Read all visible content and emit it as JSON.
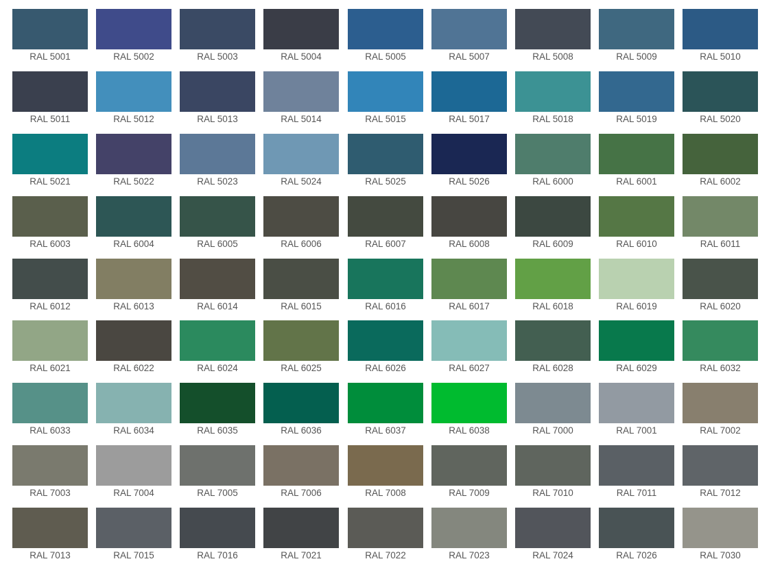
{
  "swatches": [
    {
      "label": "RAL 5001",
      "color": "#37596f"
    },
    {
      "label": "RAL 5002",
      "color": "#3f4b8a"
    },
    {
      "label": "RAL 5003",
      "color": "#3a4a64"
    },
    {
      "label": "RAL 5004",
      "color": "#3a3d47"
    },
    {
      "label": "RAL 5005",
      "color": "#2c5e8f"
    },
    {
      "label": "RAL 5007",
      "color": "#507495"
    },
    {
      "label": "RAL 5008",
      "color": "#434a55"
    },
    {
      "label": "RAL 5009",
      "color": "#3f6880"
    },
    {
      "label": "RAL 5010",
      "color": "#2c5a85"
    },
    {
      "label": "RAL 5011",
      "color": "#3a404e"
    },
    {
      "label": "RAL 5012",
      "color": "#438fbc"
    },
    {
      "label": "RAL 5013",
      "color": "#3a4662"
    },
    {
      "label": "RAL 5014",
      "color": "#6f829b"
    },
    {
      "label": "RAL 5015",
      "color": "#3285b9"
    },
    {
      "label": "RAL 5017",
      "color": "#1c6895"
    },
    {
      "label": "RAL 5018",
      "color": "#3c9294"
    },
    {
      "label": "RAL 5019",
      "color": "#33688f"
    },
    {
      "label": "RAL 5020",
      "color": "#2b5458"
    },
    {
      "label": "RAL 5021",
      "color": "#0c7d80"
    },
    {
      "label": "RAL 5022",
      "color": "#444268"
    },
    {
      "label": "RAL 5023",
      "color": "#5c7897"
    },
    {
      "label": "RAL 5024",
      "color": "#6f98b4"
    },
    {
      "label": "RAL 5025",
      "color": "#2f5c70"
    },
    {
      "label": "RAL 5026",
      "color": "#1a2753"
    },
    {
      "label": "RAL 6000",
      "color": "#4f7d6c"
    },
    {
      "label": "RAL 6001",
      "color": "#467346"
    },
    {
      "label": "RAL 6002",
      "color": "#45633c"
    },
    {
      "label": "RAL 6003",
      "color": "#5a5f4c"
    },
    {
      "label": "RAL 6004",
      "color": "#2d5655"
    },
    {
      "label": "RAL 6005",
      "color": "#365449"
    },
    {
      "label": "RAL 6006",
      "color": "#4d4c44"
    },
    {
      "label": "RAL 6007",
      "color": "#444a40"
    },
    {
      "label": "RAL 6008",
      "color": "#474641"
    },
    {
      "label": "RAL 6009",
      "color": "#3c4841"
    },
    {
      "label": "RAL 6010",
      "color": "#557745"
    },
    {
      "label": "RAL 6011",
      "color": "#738868"
    },
    {
      "label": "RAL 6012",
      "color": "#434d4b"
    },
    {
      "label": "RAL 6013",
      "color": "#827e63"
    },
    {
      "label": "RAL 6014",
      "color": "#514d44"
    },
    {
      "label": "RAL 6015",
      "color": "#4a4e45"
    },
    {
      "label": "RAL 6016",
      "color": "#18755c"
    },
    {
      "label": "RAL 6017",
      "color": "#5e8850"
    },
    {
      "label": "RAL 6018",
      "color": "#62a046"
    },
    {
      "label": "RAL 6019",
      "color": "#b9d1b0"
    },
    {
      "label": "RAL 6020",
      "color": "#49534a"
    },
    {
      "label": "RAL 6021",
      "color": "#92a686"
    },
    {
      "label": "RAL 6022",
      "color": "#4a4741"
    },
    {
      "label": "RAL 6024",
      "color": "#2b8a5e"
    },
    {
      "label": "RAL 6025",
      "color": "#627449"
    },
    {
      "label": "RAL 6026",
      "color": "#0a6a5c"
    },
    {
      "label": "RAL 6027",
      "color": "#85bcb7"
    },
    {
      "label": "RAL 6028",
      "color": "#435f51"
    },
    {
      "label": "RAL 6029",
      "color": "#08794c"
    },
    {
      "label": "RAL 6032",
      "color": "#358a5e"
    },
    {
      "label": "RAL 6033",
      "color": "#569188"
    },
    {
      "label": "RAL 6034",
      "color": "#86b2b0"
    },
    {
      "label": "RAL 6035",
      "color": "#144f2b"
    },
    {
      "label": "RAL 6036",
      "color": "#045f4f"
    },
    {
      "label": "RAL 6037",
      "color": "#008d3b"
    },
    {
      "label": "RAL 6038",
      "color": "#00bb2f"
    },
    {
      "label": "RAL 7000",
      "color": "#7d8a91"
    },
    {
      "label": "RAL 7001",
      "color": "#929aa2"
    },
    {
      "label": "RAL 7002",
      "color": "#887f6e"
    },
    {
      "label": "RAL 7003",
      "color": "#7a7a6e"
    },
    {
      "label": "RAL 7004",
      "color": "#9c9c9c"
    },
    {
      "label": "RAL 7005",
      "color": "#6e716d"
    },
    {
      "label": "RAL 7006",
      "color": "#7a7164"
    },
    {
      "label": "RAL 7008",
      "color": "#7a6a4e"
    },
    {
      "label": "RAL 7009",
      "color": "#60655e"
    },
    {
      "label": "RAL 7010",
      "color": "#5f655e"
    },
    {
      "label": "RAL 7011",
      "color": "#5a6065"
    },
    {
      "label": "RAL 7012",
      "color": "#5f6468"
    },
    {
      "label": "RAL 7013",
      "color": "#5f5c50"
    },
    {
      "label": "RAL 7015",
      "color": "#5b6066"
    },
    {
      "label": "RAL 7016",
      "color": "#454a4f"
    },
    {
      "label": "RAL 7021",
      "color": "#414446"
    },
    {
      "label": "RAL 7022",
      "color": "#5b5b56"
    },
    {
      "label": "RAL 7023",
      "color": "#84877e"
    },
    {
      "label": "RAL 7024",
      "color": "#52555b"
    },
    {
      "label": "RAL 7026",
      "color": "#495355"
    },
    {
      "label": "RAL 7030",
      "color": "#95948b"
    }
  ]
}
